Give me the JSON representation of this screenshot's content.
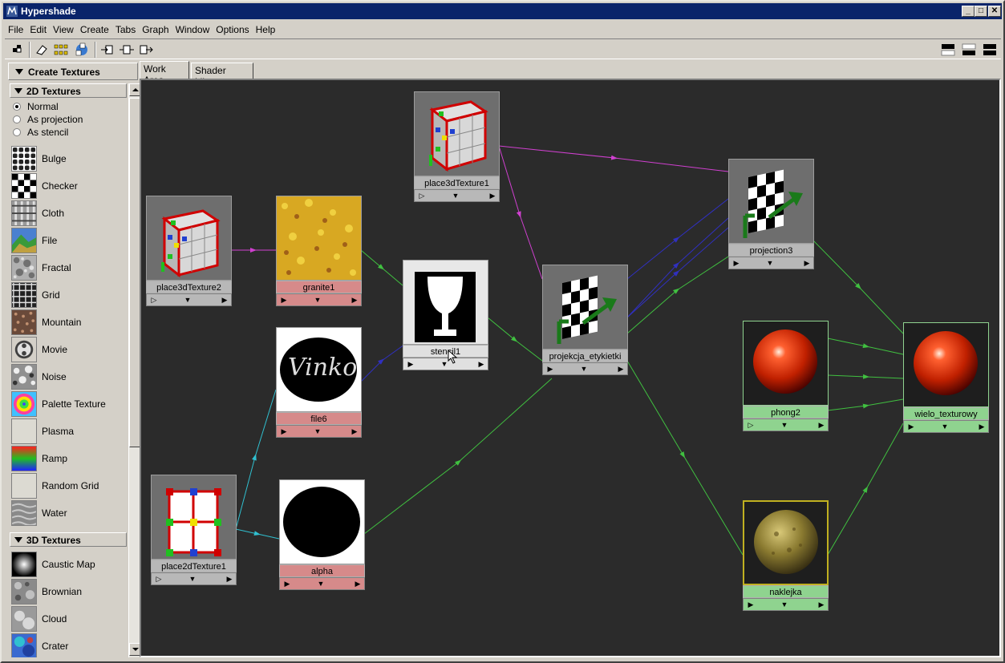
{
  "window": {
    "title": "Hypershade",
    "min": "_",
    "max": "□",
    "close": "✕"
  },
  "menu": [
    "File",
    "Edit",
    "View",
    "Create",
    "Tabs",
    "Graph",
    "Window",
    "Options",
    "Help"
  ],
  "left_panel": {
    "header": "Create Textures",
    "section_2d": "2D Textures",
    "radios": [
      {
        "label": "Normal",
        "selected": true
      },
      {
        "label": "As projection",
        "selected": false
      },
      {
        "label": "As stencil",
        "selected": false
      }
    ],
    "textures_2d": [
      "Bulge",
      "Checker",
      "Cloth",
      "File",
      "Fractal",
      "Grid",
      "Mountain",
      "Movie",
      "Noise",
      "Palette Texture",
      "Plasma",
      "Ramp",
      "Random Grid",
      "Water"
    ],
    "section_3d": "3D Textures",
    "textures_3d": [
      "Caustic Map",
      "Brownian",
      "Cloud",
      "Crater"
    ]
  },
  "tabs": [
    "Work Area",
    "Shader Library"
  ],
  "nodes": {
    "place3dTexture1": "place3dTexture1",
    "place3dTexture2": "place3dTexture2",
    "granite1": "granite1",
    "file6": "file6",
    "stencil1": "stencil1",
    "place2dTexture1": "place2dTexture1",
    "alpha": "alpha",
    "projekcja": "projekcja_etykietki",
    "projection3": "projection3",
    "phong2": "phong2",
    "naklejka": "naklejka",
    "wielo": "wielo_texturowy"
  },
  "file6_image_text": "Vinko",
  "colors": {
    "connection_magenta": "#d040d0",
    "connection_green": "#40c040",
    "connection_blue": "#3030c0",
    "connection_cyan": "#30c0d0"
  }
}
